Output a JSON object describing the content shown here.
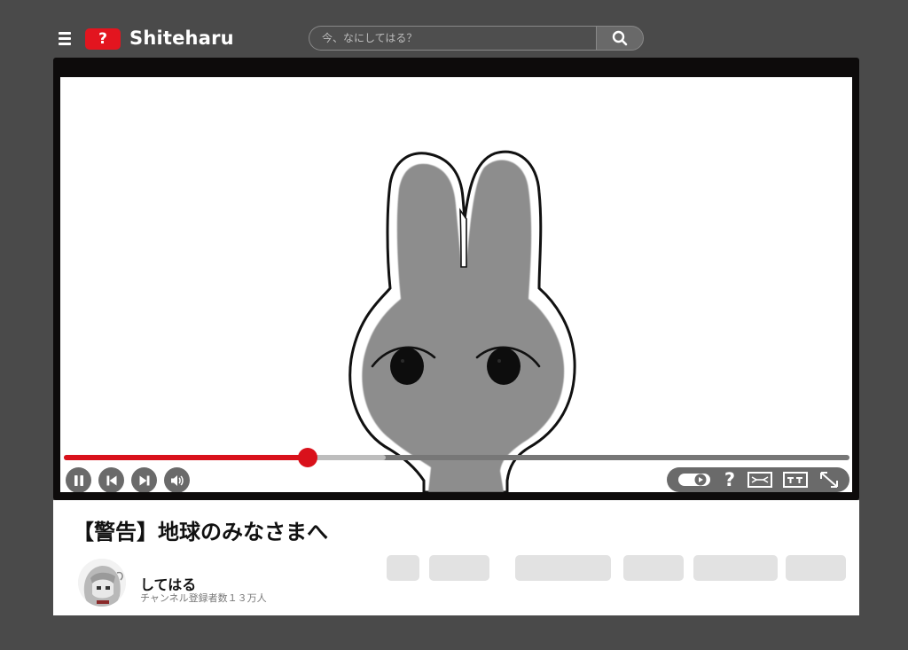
{
  "header": {
    "logo_glyph": "?",
    "brand": "Shiteharu",
    "search_placeholder": "今、なにしてはる？",
    "icons": [
      "menu-icon",
      "search-icon"
    ]
  },
  "player": {
    "progress": 0.31,
    "buffered": 0.41,
    "controls_left": [
      "pause-icon",
      "skip-previous-icon",
      "skip-next-icon",
      "volume-icon"
    ],
    "controls_right": [
      "autoplay-toggle-icon",
      "help-icon",
      "theater-mode-icon",
      "subtitles-icon",
      "fullscreen-icon"
    ]
  },
  "video": {
    "title": "【警告】地球のみなさまへ"
  },
  "channel": {
    "name": "してはる",
    "subscribers": "チャンネル登録者数１３万人"
  },
  "colors": {
    "background": "#4a4a4a",
    "accent": "#d9111b",
    "player": "#0d0b0b",
    "controls": "#6a6a6a",
    "pill": "#e2e2e2"
  }
}
